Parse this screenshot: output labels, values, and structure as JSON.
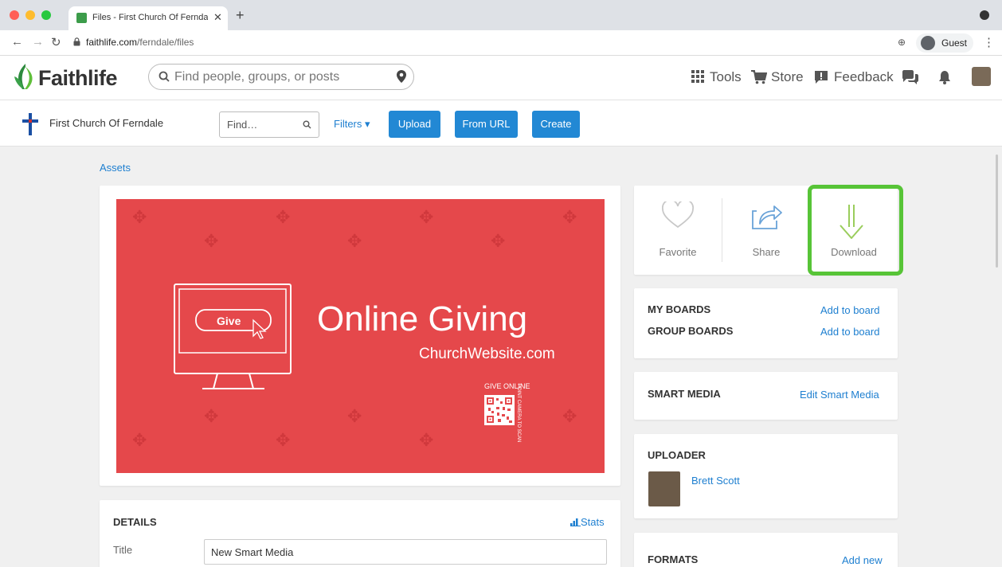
{
  "browser": {
    "tab_title": "Files - First Church Of Ferndale",
    "url_host": "faithlife.com",
    "url_path": "/ferndale/files",
    "guest_label": "Guest"
  },
  "header": {
    "logo_text": "Faithlife",
    "search_placeholder": "Find people, groups, or posts",
    "tools_label": "Tools",
    "store_label": "Store",
    "feedback_label": "Feedback"
  },
  "group": {
    "name": "First Church Of Ferndale",
    "find_placeholder": "Find…",
    "filters_label": "Filters ▾",
    "upload_label": "Upload",
    "from_url_label": "From URL",
    "create_label": "Create"
  },
  "breadcrumb": "Assets",
  "preview": {
    "give_label": "Give",
    "title": "Online Giving",
    "url": "ChurchWebsite.com",
    "give_online": "GIVE ONLINE",
    "scan_text": "POINT CAMERA TO SCAN"
  },
  "details": {
    "heading": "DETAILS",
    "stats_label": "Stats",
    "title_label": "Title",
    "title_value": "New Smart Media"
  },
  "actions": {
    "favorite": "Favorite",
    "share": "Share",
    "download": "Download"
  },
  "boards": {
    "my_boards": "MY BOARDS",
    "group_boards": "GROUP BOARDS",
    "add_to_board": "Add to board"
  },
  "smart_media": {
    "heading": "SMART MEDIA",
    "edit_label": "Edit Smart Media"
  },
  "uploader": {
    "heading": "UPLOADER",
    "name": "Brett Scott"
  },
  "formats": {
    "heading": "FORMATS",
    "add_label": "Add new"
  },
  "colors": {
    "accent": "#2288d4",
    "link": "#1e7fd0",
    "highlight": "#57c437",
    "preview_bg": "#e5484b"
  }
}
